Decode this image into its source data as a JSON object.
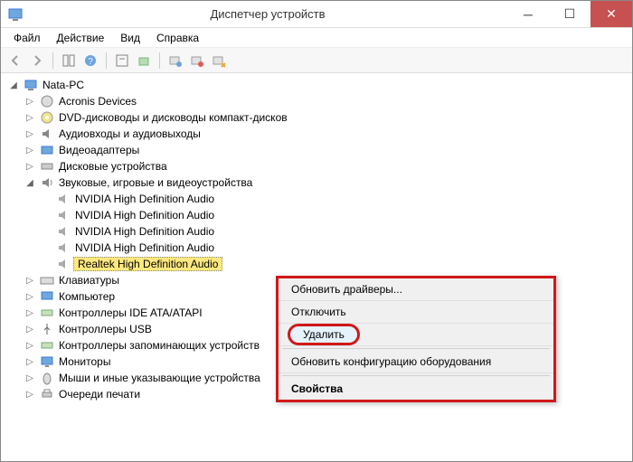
{
  "window": {
    "title": "Диспетчер устройств"
  },
  "menu": {
    "file": "Файл",
    "action": "Действие",
    "view": "Вид",
    "help": "Справка"
  },
  "tree": {
    "root": "Nata-PC",
    "items": {
      "acronis": "Acronis Devices",
      "dvd": "DVD-дисководы и дисководы компакт-дисков",
      "audio_io": "Аудиовходы и аудиовыходы",
      "video": "Видеоадаптеры",
      "disk": "Дисковые устройства",
      "sound": "Звуковые, игровые и видеоустройства",
      "nvidia1": "NVIDIA High Definition Audio",
      "nvidia2": "NVIDIA High Definition Audio",
      "nvidia3": "NVIDIA High Definition Audio",
      "nvidia4": "NVIDIA High Definition Audio",
      "realtek": "Realtek High Definition Audio",
      "keyboard": "Клавиатуры",
      "computer": "Компьютер",
      "ide": "Контроллеры IDE ATA/ATAPI",
      "usb": "Контроллеры USB",
      "store": "Контроллеры запоминающих устройств",
      "monitor": "Мониторы",
      "mice": "Мыши и иные указывающие устройства",
      "print": "Очереди печати"
    }
  },
  "context_menu": {
    "update": "Обновить драйверы...",
    "disable": "Отключить",
    "delete": "Удалить",
    "scan": "Обновить конфигурацию оборудования",
    "properties": "Свойства"
  }
}
